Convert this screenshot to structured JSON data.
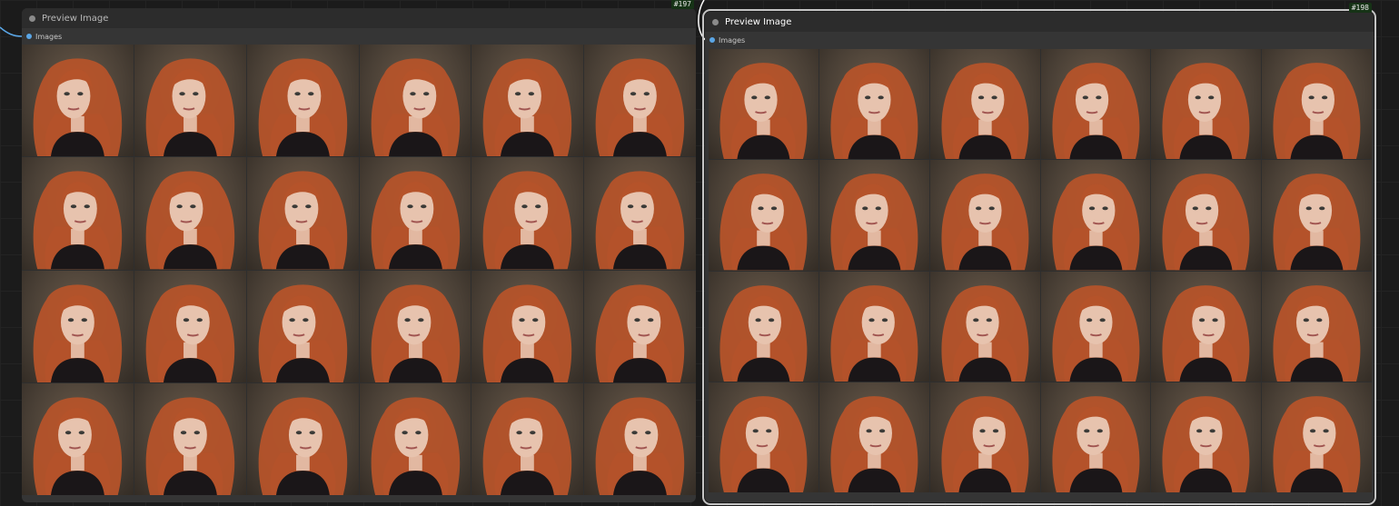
{
  "colors": {
    "canvas": "#1b1b1b",
    "node_body": "#353535",
    "socket": "#5aa6e6",
    "badge_bg": "#163316",
    "wire": "#5aa6e6",
    "hair": "#b5532a",
    "skin": "#e7c3ae",
    "clothing": "#1a1618"
  },
  "nodes": [
    {
      "id": "197",
      "badge": "#197",
      "title": "Preview Image",
      "input_label": "Images",
      "grid": {
        "rows": 4,
        "cols": 6
      },
      "selected": false
    },
    {
      "id": "198",
      "badge": "#198",
      "title": "Preview Image",
      "input_label": "Images",
      "grid": {
        "rows": 4,
        "cols": 6
      },
      "selected": true
    }
  ],
  "icons": {
    "status_dot": "node-status-dot-icon",
    "input_socket": "input-socket-icon"
  }
}
